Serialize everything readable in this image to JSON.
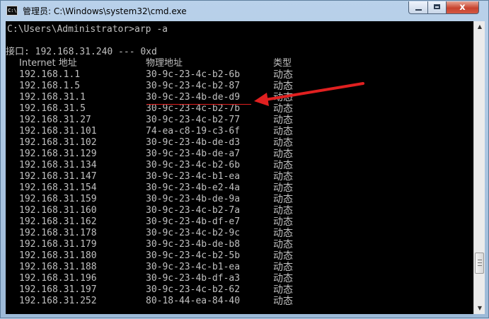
{
  "window": {
    "title": "管理员: C:\\Windows\\system32\\cmd.exe",
    "icon_text": "C:\\",
    "close_glyph": "x"
  },
  "console": {
    "command_line": "C:\\Users\\Administrator>arp -a",
    "interface_line": "接口: 192.168.31.240 --- 0xd",
    "headers": {
      "internet": "Internet 地址",
      "physical": "物理地址",
      "type": "类型"
    },
    "rows": [
      {
        "ip": "192.168.1.1",
        "mac": "30-9c-23-4c-b2-6b",
        "type": "动态"
      },
      {
        "ip": "192.168.1.5",
        "mac": "30-9c-23-4c-b2-87",
        "type": "动态"
      },
      {
        "ip": "192.168.31.1",
        "mac": "30-9c-23-4b-de-d9",
        "type": "动态"
      },
      {
        "ip": "192.168.31.5",
        "mac": "30-9c-23-4c-b2-7b",
        "type": "动态"
      },
      {
        "ip": "192.168.31.27",
        "mac": "30-9c-23-4c-b2-77",
        "type": "动态"
      },
      {
        "ip": "192.168.31.101",
        "mac": "74-ea-c8-19-c3-6f",
        "type": "动态"
      },
      {
        "ip": "192.168.31.102",
        "mac": "30-9c-23-4b-de-d3",
        "type": "动态"
      },
      {
        "ip": "192.168.31.129",
        "mac": "30-9c-23-4b-de-a7",
        "type": "动态"
      },
      {
        "ip": "192.168.31.134",
        "mac": "30-9c-23-4c-b2-6b",
        "type": "动态"
      },
      {
        "ip": "192.168.31.147",
        "mac": "30-9c-23-4c-b1-ea",
        "type": "动态"
      },
      {
        "ip": "192.168.31.154",
        "mac": "30-9c-23-4b-e2-4a",
        "type": "动态"
      },
      {
        "ip": "192.168.31.159",
        "mac": "30-9c-23-4b-de-9a",
        "type": "动态"
      },
      {
        "ip": "192.168.31.160",
        "mac": "30-9c-23-4c-b2-7a",
        "type": "动态"
      },
      {
        "ip": "192.168.31.162",
        "mac": "30-9c-23-4b-df-e7",
        "type": "动态"
      },
      {
        "ip": "192.168.31.178",
        "mac": "30-9c-23-4c-b2-9c",
        "type": "动态"
      },
      {
        "ip": "192.168.31.179",
        "mac": "30-9c-23-4b-de-b8",
        "type": "动态"
      },
      {
        "ip": "192.168.31.180",
        "mac": "30-9c-23-4c-b2-5b",
        "type": "动态"
      },
      {
        "ip": "192.168.31.188",
        "mac": "30-9c-23-4c-b1-ea",
        "type": "动态"
      },
      {
        "ip": "192.168.31.196",
        "mac": "30-9c-23-4b-df-a3",
        "type": "动态"
      },
      {
        "ip": "192.168.31.197",
        "mac": "30-9c-23-4c-b2-62",
        "type": "动态"
      },
      {
        "ip": "192.168.31.252",
        "mac": "80-18-44-ea-84-40",
        "type": "动态"
      }
    ]
  },
  "scrollbar": {
    "up_glyph": "▲",
    "down_glyph": "▼"
  },
  "annotation": {
    "color": "#e02020",
    "highlighted_row": 2
  },
  "colors": {
    "console_bg": "#000000",
    "console_text": "#c0c0c0",
    "close_button": "#c7432f"
  }
}
